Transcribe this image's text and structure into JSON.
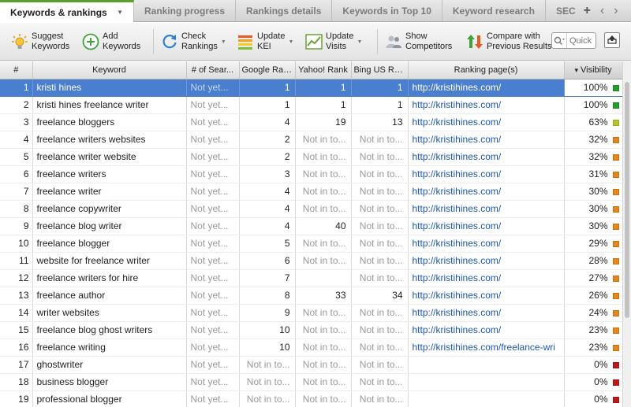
{
  "tabs": [
    {
      "label": "Keywords & rankings",
      "active": true
    },
    {
      "label": "Ranking progress"
    },
    {
      "label": "Rankings details"
    },
    {
      "label": "Keywords in Top 10"
    },
    {
      "label": "Keyword research"
    },
    {
      "label": "SEC"
    }
  ],
  "tab_tools": {
    "add": "+",
    "prev": "‹",
    "next": "›"
  },
  "toolbar": {
    "suggest": "Suggest\nKeywords",
    "add": "Add\nKeywords",
    "check": "Check\nRankings",
    "update_kei": "Update\nKEI",
    "update_visits": "Update\nVisits",
    "competitors": "Show\nCompetitors",
    "compare": "Compare with\nPrevious Results",
    "search_placeholder": "Quick"
  },
  "table": {
    "headers": {
      "idx": "#",
      "keyword": "Keyword",
      "searches": "# of Sear...",
      "google": "Google Rank",
      "yahoo": "Yahoo! Rank",
      "bing": "Bing US Ra...",
      "page": "Ranking page(s)",
      "visibility": "Visibility",
      "sort_icon": "▾"
    },
    "rows": [
      {
        "idx": "1",
        "keyword": "kristi hines",
        "searches": "Not yet...",
        "google": "1",
        "yahoo": "1",
        "bing": "1",
        "page": "http://kristihines.com/",
        "visibility": "100%",
        "color": "#22a02a",
        "selected": true
      },
      {
        "idx": "2",
        "keyword": "kristi hines freelance writer",
        "searches": "Not yet...",
        "google": "1",
        "yahoo": "1",
        "bing": "1",
        "page": "http://kristihines.com/",
        "visibility": "100%",
        "color": "#22a02a"
      },
      {
        "idx": "3",
        "keyword": "freelance bloggers",
        "searches": "Not yet...",
        "google": "4",
        "yahoo": "19",
        "bing": "13",
        "page": "http://kristihines.com/",
        "visibility": "63%",
        "color": "#b8c52a"
      },
      {
        "idx": "4",
        "keyword": "freelance writers websites",
        "searches": "Not yet...",
        "google": "2",
        "yahoo": "Not in to...",
        "bing": "Not in to...",
        "page": "http://kristihines.com/",
        "visibility": "32%",
        "color": "#e8861c"
      },
      {
        "idx": "5",
        "keyword": "freelance writer website",
        "searches": "Not yet...",
        "google": "2",
        "yahoo": "Not in to...",
        "bing": "Not in to...",
        "page": "http://kristihines.com/",
        "visibility": "32%",
        "color": "#e8861c"
      },
      {
        "idx": "6",
        "keyword": "freelance writers",
        "searches": "Not yet...",
        "google": "3",
        "yahoo": "Not in to...",
        "bing": "Not in to...",
        "page": "http://kristihines.com/",
        "visibility": "31%",
        "color": "#e8861c"
      },
      {
        "idx": "7",
        "keyword": "freelance writer",
        "searches": "Not yet...",
        "google": "4",
        "yahoo": "Not in to...",
        "bing": "Not in to...",
        "page": "http://kristihines.com/",
        "visibility": "30%",
        "color": "#e8861c"
      },
      {
        "idx": "8",
        "keyword": "freelance copywriter",
        "searches": "Not yet...",
        "google": "4",
        "yahoo": "Not in to...",
        "bing": "Not in to...",
        "page": "http://kristihines.com/",
        "visibility": "30%",
        "color": "#e8861c"
      },
      {
        "idx": "9",
        "keyword": "freelance blog writer",
        "searches": "Not yet...",
        "google": "4",
        "yahoo": "40",
        "bing": "Not in to...",
        "page": "http://kristihines.com/",
        "visibility": "30%",
        "color": "#e8861c"
      },
      {
        "idx": "10",
        "keyword": "freelance blogger",
        "searches": "Not yet...",
        "google": "5",
        "yahoo": "Not in to...",
        "bing": "Not in to...",
        "page": "http://kristihines.com/",
        "visibility": "29%",
        "color": "#e8861c"
      },
      {
        "idx": "11",
        "keyword": "website for freelance writer",
        "searches": "Not yet...",
        "google": "6",
        "yahoo": "Not in to...",
        "bing": "Not in to...",
        "page": "http://kristihines.com/",
        "visibility": "28%",
        "color": "#e8861c"
      },
      {
        "idx": "12",
        "keyword": "freelance writers for hire",
        "searches": "Not yet...",
        "google": "7",
        "yahoo": "",
        "bing": "Not in to...",
        "page": "http://kristihines.com/",
        "visibility": "27%",
        "color": "#e8861c"
      },
      {
        "idx": "13",
        "keyword": "freelance author",
        "searches": "Not yet...",
        "google": "8",
        "yahoo": "33",
        "bing": "34",
        "page": "http://kristihines.com/",
        "visibility": "26%",
        "color": "#e8861c"
      },
      {
        "idx": "14",
        "keyword": "writer websites",
        "searches": "Not yet...",
        "google": "9",
        "yahoo": "Not in to...",
        "bing": "Not in to...",
        "page": "http://kristihines.com/",
        "visibility": "24%",
        "color": "#e8861c"
      },
      {
        "idx": "15",
        "keyword": "freelance blog ghost writers",
        "searches": "Not yet...",
        "google": "10",
        "yahoo": "Not in to...",
        "bing": "Not in to...",
        "page": "http://kristihines.com/",
        "visibility": "23%",
        "color": "#e8861c"
      },
      {
        "idx": "16",
        "keyword": "freelance writing",
        "searches": "Not yet...",
        "google": "10",
        "yahoo": "Not in to...",
        "bing": "Not in to...",
        "page": "http://kristihines.com/freelance-wri",
        "visibility": "23%",
        "color": "#e8861c"
      },
      {
        "idx": "17",
        "keyword": "ghostwriter",
        "searches": "Not yet...",
        "google": "Not in to...",
        "yahoo": "Not in to...",
        "bing": "Not in to...",
        "page": "",
        "visibility": "0%",
        "color": "#c01818"
      },
      {
        "idx": "18",
        "keyword": "business blogger",
        "searches": "Not yet...",
        "google": "Not in to...",
        "yahoo": "Not in to...",
        "bing": "Not in to...",
        "page": "",
        "visibility": "0%",
        "color": "#c01818"
      },
      {
        "idx": "19",
        "keyword": "professional blogger",
        "searches": "Not yet...",
        "google": "Not in to...",
        "yahoo": "Not in to...",
        "bing": "Not in to...",
        "page": "",
        "visibility": "0%",
        "color": "#c01818"
      }
    ]
  }
}
